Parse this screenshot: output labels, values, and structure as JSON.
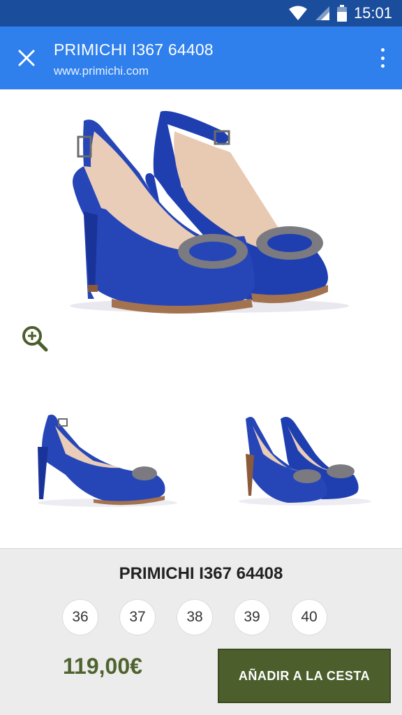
{
  "status_bar": {
    "time": "15:01",
    "icons": [
      "wifi-icon",
      "signal-icon",
      "battery-icon"
    ]
  },
  "app_bar": {
    "title": "PRIMICHI I367 64408",
    "url": "www.primichi.com",
    "close_icon": "close-icon",
    "menu_icon": "more-vert-icon"
  },
  "product": {
    "name": "PRIMICHI I367 64408",
    "sizes": [
      "36",
      "37",
      "38",
      "39",
      "40"
    ],
    "price": "119,00€",
    "add_to_cart_label": "AÑADIR A LA CESTA",
    "zoom_icon": "zoom-in-icon"
  },
  "colors": {
    "status_bar": "#1a4e9c",
    "app_bar": "#2f80ed",
    "shoe": "#1f3fb0",
    "accent_green": "#4b5e2b",
    "price_green": "#4f6330"
  }
}
